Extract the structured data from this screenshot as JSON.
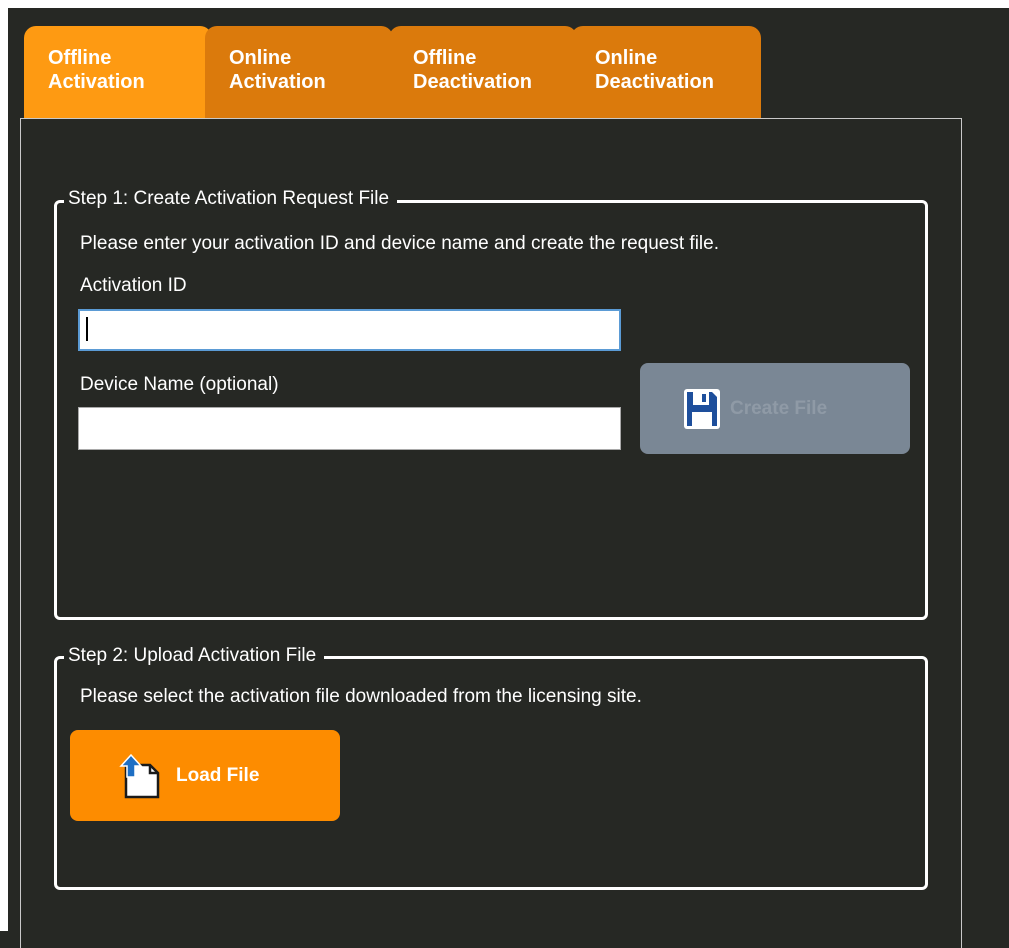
{
  "tabs": [
    {
      "line1": "Offline",
      "line2": "Activation"
    },
    {
      "line1": "Online",
      "line2": "Activation"
    },
    {
      "line1": "Offline",
      "line2": "Deactivation"
    },
    {
      "line1": "Online",
      "line2": "Deactivation"
    }
  ],
  "active_tab": 0,
  "step1": {
    "title": "Step 1: Create Activation Request File",
    "instruction": "Please enter your activation ID and device name and create the request file.",
    "activation_id_label": "Activation ID",
    "activation_id_value": "",
    "device_name_label": "Device Name (optional)",
    "device_name_value": "",
    "create_button_label": "Create File",
    "create_button_icon": "save-icon",
    "create_button_enabled": false
  },
  "step2": {
    "title": "Step 2: Upload Activation File",
    "instruction": "Please select the activation file downloaded from the licensing site.",
    "load_button_label": "Load File",
    "load_button_icon": "upload-file-icon"
  },
  "colors": {
    "background": "#262824",
    "tab_active": "#fe9a12",
    "tab_inactive": "#db7a0c",
    "load_button": "#fd8c00",
    "create_button_disabled": "#7a8795",
    "save_icon_blue": "#1e4f9c"
  }
}
